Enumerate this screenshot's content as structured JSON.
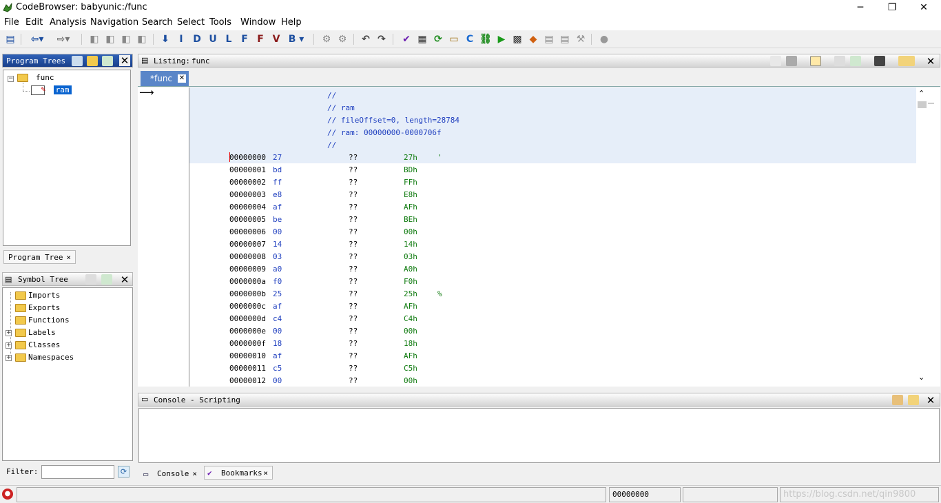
{
  "window": {
    "title": "CodeBrowser: babyunic:/func",
    "minimize": "─",
    "restore": "❐",
    "close": "✕"
  },
  "menu": [
    "File",
    "Edit",
    "Analysis",
    "Navigation",
    "Search",
    "Select",
    "Tools",
    "Window",
    "Help"
  ],
  "program_trees": {
    "title": "Program Trees",
    "root": "func",
    "child": "ram",
    "tab_label": "Program Tree"
  },
  "symbol_tree": {
    "title": "Symbol Tree",
    "items": [
      "Imports",
      "Exports",
      "Functions",
      "Labels",
      "Classes",
      "Namespaces"
    ],
    "filter_label": "Filter:",
    "filter_value": ""
  },
  "listing": {
    "title": "Listing:",
    "program": "func",
    "tab_label": "*func",
    "header_comments": [
      "//",
      "// ram",
      "// fileOffset=0, length=28784",
      "// ram: 00000000-0000706f",
      "//"
    ],
    "rows": [
      {
        "addr": "00000000",
        "byte": "27",
        "mn": "??",
        "val": "27h",
        "asc": "'"
      },
      {
        "addr": "00000001",
        "byte": "bd",
        "mn": "??",
        "val": "BDh",
        "asc": ""
      },
      {
        "addr": "00000002",
        "byte": "ff",
        "mn": "??",
        "val": "FFh",
        "asc": ""
      },
      {
        "addr": "00000003",
        "byte": "e8",
        "mn": "??",
        "val": "E8h",
        "asc": ""
      },
      {
        "addr": "00000004",
        "byte": "af",
        "mn": "??",
        "val": "AFh",
        "asc": ""
      },
      {
        "addr": "00000005",
        "byte": "be",
        "mn": "??",
        "val": "BEh",
        "asc": ""
      },
      {
        "addr": "00000006",
        "byte": "00",
        "mn": "??",
        "val": "00h",
        "asc": ""
      },
      {
        "addr": "00000007",
        "byte": "14",
        "mn": "??",
        "val": "14h",
        "asc": ""
      },
      {
        "addr": "00000008",
        "byte": "03",
        "mn": "??",
        "val": "03h",
        "asc": ""
      },
      {
        "addr": "00000009",
        "byte": "a0",
        "mn": "??",
        "val": "A0h",
        "asc": ""
      },
      {
        "addr": "0000000a",
        "byte": "f0",
        "mn": "??",
        "val": "F0h",
        "asc": ""
      },
      {
        "addr": "0000000b",
        "byte": "25",
        "mn": "??",
        "val": "25h",
        "asc": "%"
      },
      {
        "addr": "0000000c",
        "byte": "af",
        "mn": "??",
        "val": "AFh",
        "asc": ""
      },
      {
        "addr": "0000000d",
        "byte": "c4",
        "mn": "??",
        "val": "C4h",
        "asc": ""
      },
      {
        "addr": "0000000e",
        "byte": "00",
        "mn": "??",
        "val": "00h",
        "asc": ""
      },
      {
        "addr": "0000000f",
        "byte": "18",
        "mn": "??",
        "val": "18h",
        "asc": ""
      },
      {
        "addr": "00000010",
        "byte": "af",
        "mn": "??",
        "val": "AFh",
        "asc": ""
      },
      {
        "addr": "00000011",
        "byte": "c5",
        "mn": "??",
        "val": "C5h",
        "asc": ""
      },
      {
        "addr": "00000012",
        "byte": "00",
        "mn": "??",
        "val": "00h",
        "asc": ""
      }
    ]
  },
  "console": {
    "title": "Console - Scripting",
    "tabs": [
      "Console",
      "Bookmarks"
    ]
  },
  "status": {
    "address": "00000000",
    "watermark": "https://blog.csdn.net/qin9800"
  },
  "colors": {
    "selection": "#0a64d0",
    "listing_highlight": "#e6eef9",
    "header_active": "#1a3f8a"
  }
}
